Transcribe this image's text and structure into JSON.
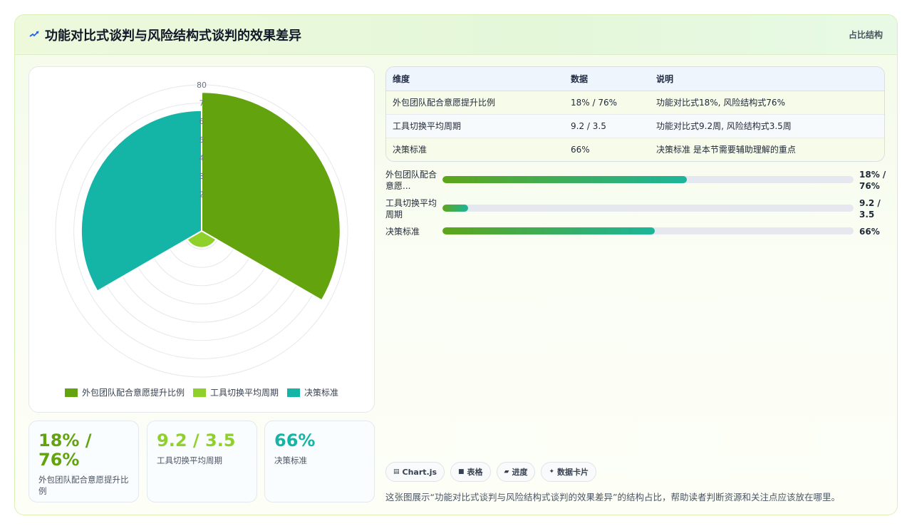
{
  "header": {
    "title": "功能对比式谈判与风险结构式谈判的效果差异",
    "tag": "占比结构"
  },
  "chart_data": {
    "type": "polarArea",
    "r_ticks": [
      "80",
      "7",
      "6",
      "5",
      "4",
      "3",
      "2"
    ],
    "r_max": 80,
    "series": [
      {
        "name": "外包团队配合意愿提升比例",
        "value": 76,
        "color": "#62a30e"
      },
      {
        "name": "工具切换平均周期",
        "value": 9.2,
        "color": "#8fd12a"
      },
      {
        "name": "决策标准",
        "value": 66,
        "color": "#14b5a6"
      }
    ]
  },
  "table": {
    "headers": [
      "维度",
      "数据",
      "说明"
    ],
    "rows": [
      [
        "外包团队配合意愿提升比例",
        "18% / 76%",
        "功能对比式18%, 风险结构式76%"
      ],
      [
        "工具切换平均周期",
        "9.2 / 3.5",
        "功能对比式9.2周, 风险结构式3.5周"
      ],
      [
        "决策标准",
        "66%",
        "决策标准 是本节需要辅助理解的重点"
      ]
    ]
  },
  "bars": [
    {
      "label": "外包团队配合意愿...",
      "value": "18% / 76%",
      "fraction": 0.595
    },
    {
      "label": "工具切换平均周期",
      "value": "9.2 / 3.5",
      "fraction": 0.062
    },
    {
      "label": "决策标准",
      "value": "66%",
      "fraction": 0.517
    }
  ],
  "stats": [
    {
      "value": "18% / 76%",
      "label": "外包团队配合意愿提升比例",
      "color": "#62a30e"
    },
    {
      "value": "9.2 / 3.5",
      "label": "工具切换平均周期",
      "color": "#8fd12a"
    },
    {
      "value": "66%",
      "label": "决策标准",
      "color": "#14b5a6"
    }
  ],
  "chips": [
    {
      "icon": "chart-icon",
      "label": "Chart.js"
    },
    {
      "icon": "table-icon",
      "label": "表格"
    },
    {
      "icon": "progress-icon",
      "label": "进度"
    },
    {
      "icon": "sparkle-icon",
      "label": "数据卡片"
    }
  ],
  "caption": "这张图展示“功能对比式谈判与风险结构式谈判的效果差异”的结构占比，帮助读者判断资源和关注点应该放在哪里。"
}
